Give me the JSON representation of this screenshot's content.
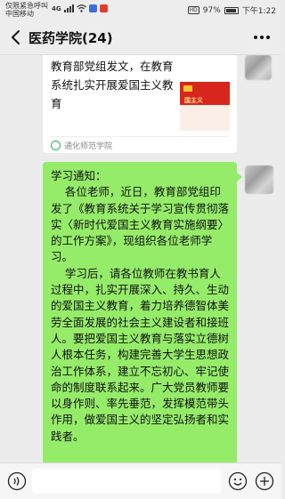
{
  "status_bar": {
    "carrier_line1": "仅限紧急呼叫",
    "carrier_line2": "中国移动",
    "network": "4G",
    "hd": "HD",
    "battery": "97%",
    "time": "下午1:22"
  },
  "header": {
    "title": "医药学院(24)"
  },
  "shared_article": {
    "title": "教育部党组发文，在教育系统扎实开展爱国主义教育",
    "thumbnail_text": "国主义",
    "source": "通化师范学院"
  },
  "message": {
    "text": "学习通知：\n    各位老师，近日，教育部党组印发了《教育系统关于学习宣传贯彻落实〈新时代爱国主义教育实施纲要〉的工作方案》，现组织各位老师学习。\n    学习后，请各位教师在教书育人过程中，扎实开展深入、持久、生动的爱国主义教育，着力培养德智体美劳全面发展的社会主义建设者和接班人。要把爱国主义教育与落实立德树人根本任务，构建完善大学生思想政治工作体系，建立不忘初心、牢记使命的制度联系起来。广大党员教师要以身作则、率先垂范，发挥模范带头作用，做爱国主义的坚定弘扬者和实践者。"
  },
  "input_bar": {
    "value": ""
  },
  "icons": {
    "back": "chevron-left-icon",
    "more": "more-dots-icon",
    "voice": "voice-icon",
    "emoji": "emoji-icon",
    "plus": "plus-icon"
  },
  "colors": {
    "bubble_green": "#95ec69",
    "brand_green": "#2aae67",
    "thumb_red": "#d7261c"
  }
}
